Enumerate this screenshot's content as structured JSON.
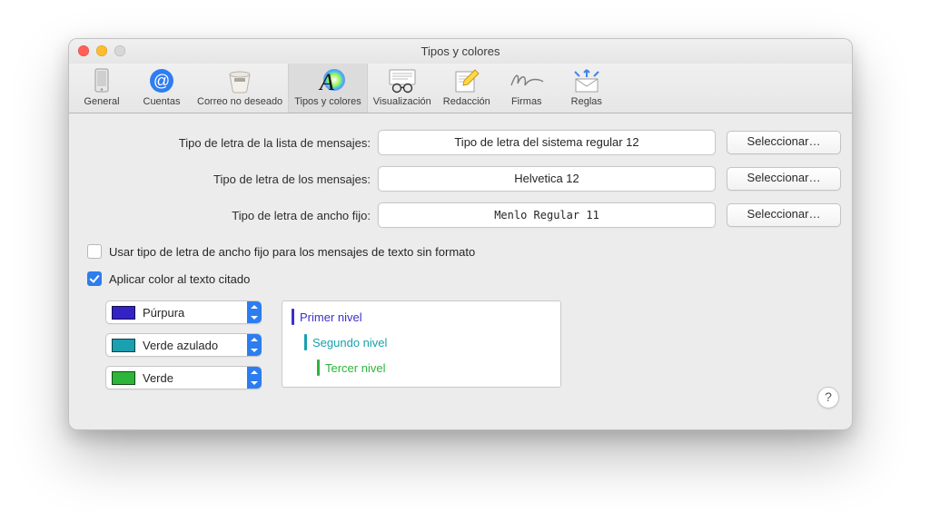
{
  "window": {
    "title": "Tipos y colores"
  },
  "toolbar": {
    "items": [
      {
        "label": "General"
      },
      {
        "label": "Cuentas"
      },
      {
        "label": "Correo no deseado"
      },
      {
        "label": "Tipos y colores"
      },
      {
        "label": "Visualización"
      },
      {
        "label": "Redacción"
      },
      {
        "label": "Firmas"
      },
      {
        "label": "Reglas"
      }
    ],
    "active_index": 3
  },
  "fonts": {
    "rows": [
      {
        "label": "Tipo de letra de la lista de mensajes:",
        "value": "Tipo de letra del sistema regular 12"
      },
      {
        "label": "Tipo de letra de los mensajes:",
        "value": "Helvetica 12"
      },
      {
        "label": "Tipo de letra de ancho fijo:",
        "value": "Menlo Regular 11"
      }
    ],
    "select_label": "Seleccionar…"
  },
  "checks": {
    "fixed_width": {
      "label": "Usar tipo de letra de ancho fijo para los mensajes de texto sin formato",
      "checked": false
    },
    "quote_color": {
      "label": "Aplicar color al texto citado",
      "checked": true
    }
  },
  "quote_levels": {
    "selects": [
      {
        "name": "Púrpura",
        "swatch": "#3423c4"
      },
      {
        "name": "Verde azulado",
        "swatch": "#1aa0b0"
      },
      {
        "name": "Verde",
        "swatch": "#2db53a"
      }
    ],
    "preview": [
      {
        "text": "Primer nivel",
        "color": "#3c2fca",
        "bar": "#3c2fca"
      },
      {
        "text": "Segundo nivel",
        "color": "#17a2ac",
        "bar": "#17a2ac"
      },
      {
        "text": "Tercer nivel",
        "color": "#2db53a",
        "bar": "#2db53a"
      }
    ]
  },
  "help": {
    "glyph": "?"
  }
}
